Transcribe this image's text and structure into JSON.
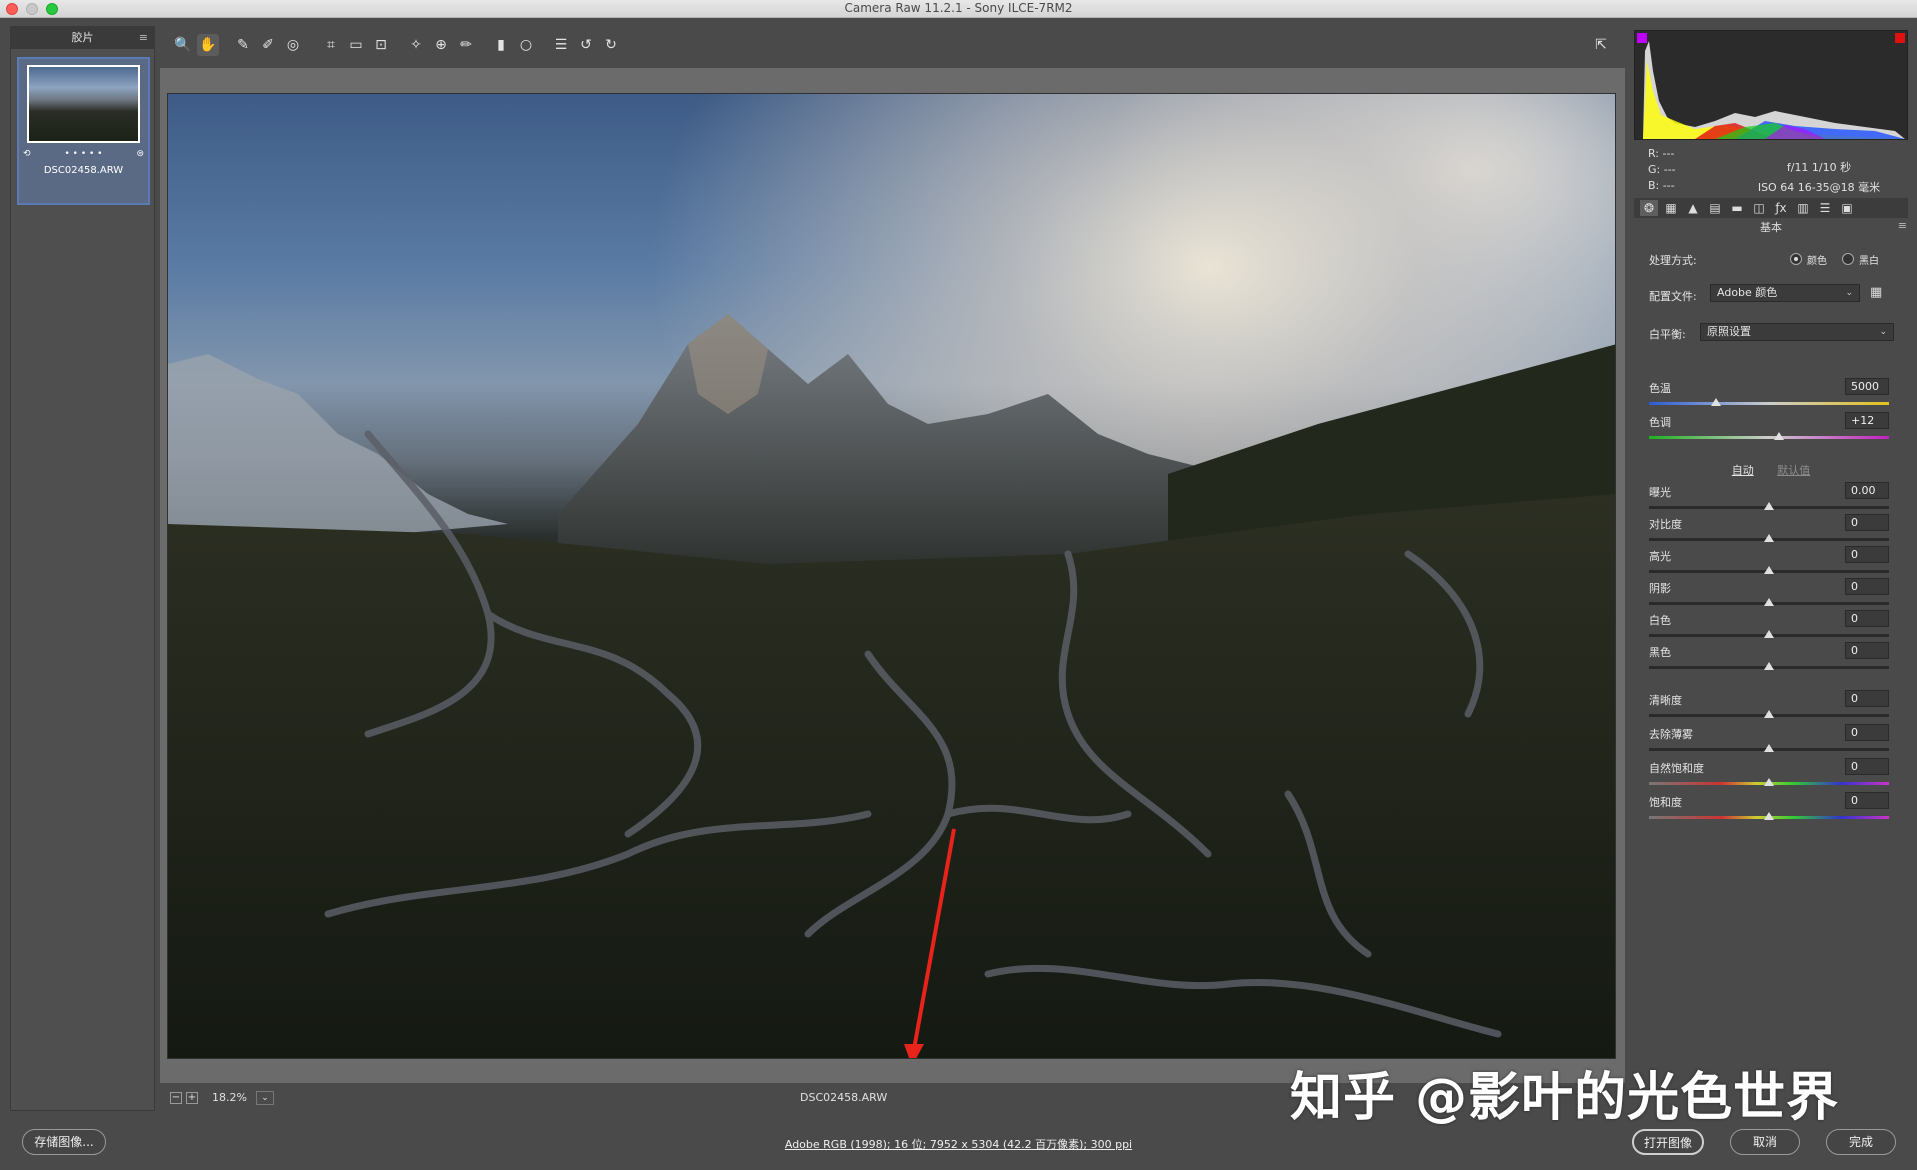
{
  "window": {
    "title": "Camera Raw 11.2.1 -  Sony ILCE-7RM2"
  },
  "filmstrip": {
    "header": "胶片",
    "menu_icon": "≡",
    "thumbnail": {
      "filename": "DSC02458.ARW",
      "rating_dots": "• • • • •"
    }
  },
  "toolbar": {
    "tools": [
      {
        "name": "zoom-tool-icon",
        "glyph": "🔍"
      },
      {
        "name": "hand-tool-icon",
        "glyph": "✋"
      },
      {
        "name": "white-balance-tool-icon",
        "glyph": "✎"
      },
      {
        "name": "color-sampler-tool-icon",
        "glyph": "✐"
      },
      {
        "name": "targeted-adjustment-tool-icon",
        "glyph": "◎"
      },
      {
        "name": "crop-tool-icon",
        "glyph": "⌗"
      },
      {
        "name": "straighten-tool-icon",
        "glyph": "▭"
      },
      {
        "name": "transform-tool-icon",
        "glyph": "⊡"
      },
      {
        "name": "spot-removal-tool-icon",
        "glyph": "✧"
      },
      {
        "name": "red-eye-tool-icon",
        "glyph": "⊕"
      },
      {
        "name": "adjustment-brush-icon",
        "glyph": "✏"
      },
      {
        "name": "graduated-filter-icon",
        "glyph": "▮"
      },
      {
        "name": "radial-filter-icon",
        "glyph": "○"
      },
      {
        "name": "preferences-icon",
        "glyph": "☰"
      },
      {
        "name": "rotate-ccw-icon",
        "glyph": "↺"
      },
      {
        "name": "rotate-cw-icon",
        "glyph": "↻"
      }
    ],
    "fullscreen_glyph": "⇱"
  },
  "status": {
    "zoom": "18.2%",
    "filename": "DSC02458.ARW"
  },
  "right_panel": {
    "info": {
      "r": "R:   ---",
      "g": "G:   ---",
      "b": "B:   ---",
      "exposure": "f/11     1/10 秒",
      "iso_lens": "ISO 64    16-35@18 毫米"
    },
    "tabs": [
      "❂",
      "▦",
      "▲",
      "▤",
      "▬",
      "◫",
      "ƒx",
      "▥",
      "☰",
      "▣"
    ],
    "panel_title": "基本",
    "treatment_label": "处理方式:",
    "treatment_color": "颜色",
    "treatment_bw": "黑白",
    "profile_label": "配置文件:",
    "profile_value": "Adobe 颜色",
    "wb_label": "白平衡:",
    "wb_value": "原照设置",
    "auto": "自动",
    "default": "默认值",
    "sliders_wb": [
      {
        "label": "色温",
        "value": "5000",
        "pos": 0.28
      },
      {
        "label": "色调",
        "value": "+12",
        "pos": 0.54
      }
    ],
    "sliders_tone": [
      {
        "label": "曝光",
        "value": "0.00",
        "pos": 0.5
      },
      {
        "label": "对比度",
        "value": "0",
        "pos": 0.5
      },
      {
        "label": "高光",
        "value": "0",
        "pos": 0.5
      },
      {
        "label": "阴影",
        "value": "0",
        "pos": 0.5
      },
      {
        "label": "白色",
        "value": "0",
        "pos": 0.5
      },
      {
        "label": "黑色",
        "value": "0",
        "pos": 0.5
      }
    ],
    "sliders_presence": [
      {
        "label": "清晰度",
        "value": "0",
        "pos": 0.5
      },
      {
        "label": "去除薄雾",
        "value": "0",
        "pos": 0.5
      },
      {
        "label": "自然饱和度",
        "value": "0",
        "pos": 0.5
      },
      {
        "label": "饱和度",
        "value": "0",
        "pos": 0.5
      }
    ]
  },
  "bottom": {
    "save_button": "存储图像...",
    "workflow_link": "Adobe RGB (1998); 16 位;  7952 x 5304 (42.2 百万像素); 300 ppi",
    "open_button": "打开图像",
    "cancel_button": "取消",
    "done_button": "完成"
  },
  "watermark": "知乎 @影叶的光色世界",
  "colors": {
    "accent": "#5b7bb5",
    "annotation_arrow": "#e8231b",
    "close": "#fe5f57",
    "minimize": "#febc2e",
    "zoom": "#28c840"
  }
}
